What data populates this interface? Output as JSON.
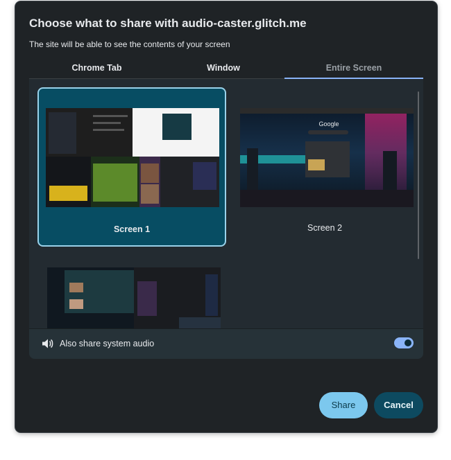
{
  "dialog": {
    "title": "Choose what to share with audio-caster.glitch.me",
    "subtitle": "The site will be able to see the contents of your screen"
  },
  "tabs": [
    {
      "label": "Chrome Tab"
    },
    {
      "label": "Window"
    },
    {
      "label": "Entire Screen",
      "selected": true
    }
  ],
  "screens": [
    {
      "label": "Screen 1",
      "selected": true
    },
    {
      "label": "Screen 2",
      "selected": false
    },
    {
      "label": "",
      "selected": false
    }
  ],
  "screen2_preview_text": "Google",
  "audio": {
    "label": "Also share system audio",
    "enabled": true,
    "icon": "speaker-icon"
  },
  "buttons": {
    "share": "Share",
    "cancel": "Cancel"
  },
  "colors": {
    "accent": "#8ab4f8",
    "selected_card": "#074d63",
    "share_button": "#7cc8ee",
    "cancel_button": "#0d4a60"
  }
}
